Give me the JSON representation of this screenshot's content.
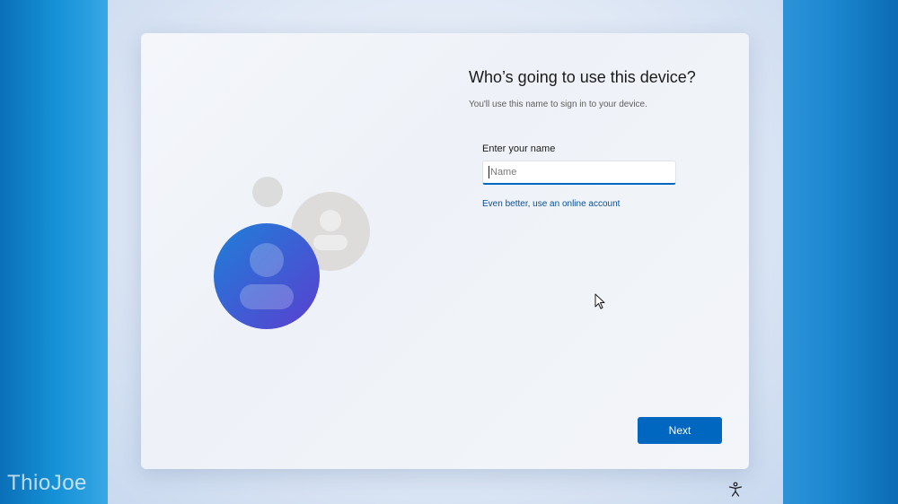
{
  "setup": {
    "title": "Who’s going to use this device?",
    "subtitle": "You'll use this name to sign in to your device.",
    "name_field": {
      "label": "Enter your name",
      "placeholder": "Name",
      "value": ""
    },
    "online_account_link": "Even better, use an online account",
    "next_label": "Next"
  },
  "icons": {
    "illustration": "user-accounts-illustration",
    "accessibility": "accessibility-icon",
    "cursor": "mouse-pointer-icon"
  },
  "watermark": "ThioJoe",
  "colors": {
    "accent": "#0067c0",
    "link": "#0a4f94",
    "avatar_primary": "#3a5fd6",
    "avatar_secondary": "#dedede"
  }
}
